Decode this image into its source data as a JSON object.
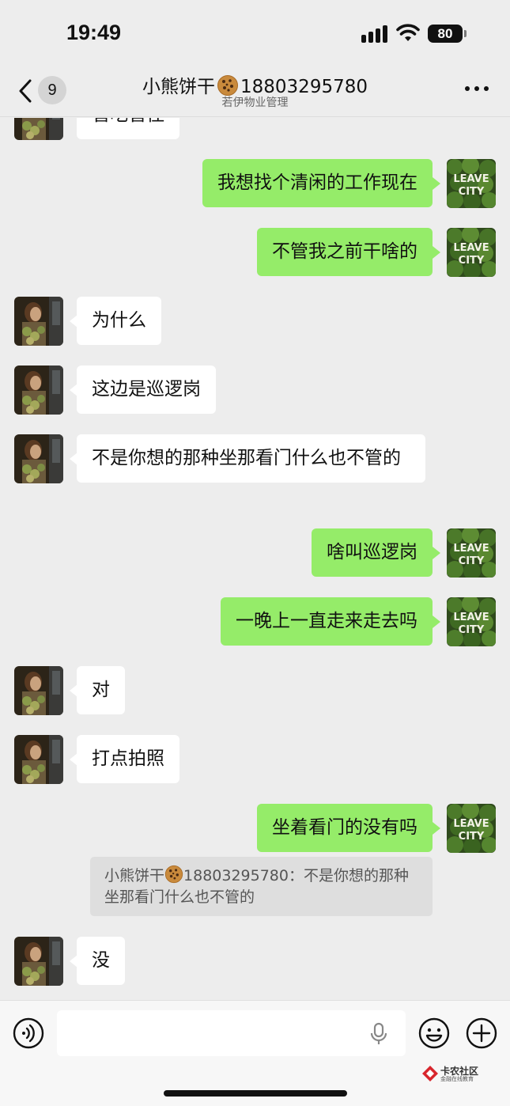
{
  "status_bar": {
    "time": "19:49",
    "battery": "80"
  },
  "nav": {
    "unread_count": "9",
    "title_name": "小熊饼干",
    "title_phone": "18803295780",
    "subtitle": "若伊物业管理"
  },
  "messages": {
    "m0": {
      "side": "in",
      "text": "管吃管住"
    },
    "m1": {
      "side": "out",
      "text": "我想找个清闲的工作现在"
    },
    "m2": {
      "side": "out",
      "text": "不管我之前干啥的"
    },
    "m3": {
      "side": "in",
      "text": "为什么"
    },
    "m4": {
      "side": "in",
      "text": "这边是巡逻岗"
    },
    "m5": {
      "side": "in",
      "text": "不是你想的那种坐那看门什么也不管的"
    },
    "m6": {
      "side": "out",
      "text": "啥叫巡逻岗"
    },
    "m7": {
      "side": "out",
      "text": "一晚上一直走来走去吗"
    },
    "m8": {
      "side": "in",
      "text": "对"
    },
    "m9": {
      "side": "in",
      "text": "打点拍照"
    },
    "m10": {
      "side": "out",
      "text": "坐着看门的没有吗"
    },
    "m11": {
      "side": "in",
      "text": "没"
    }
  },
  "quote": {
    "author": "小熊饼干",
    "author_phone": "18803295780",
    "separator": "：",
    "text": "不是你想的那种坐那看门什么也不管的"
  },
  "avatar_text": {
    "line1": "LEAVE",
    "line2": "CITY"
  },
  "input": {
    "value": ""
  },
  "watermark": {
    "title": "卡农社区",
    "subtitle": "金融在线教育"
  },
  "colors": {
    "background": "#ededed",
    "outgoing_bubble": "#95ec69",
    "incoming_bubble": "#ffffff"
  },
  "icons": [
    "back-chevron-icon",
    "more-icon",
    "voice-icon",
    "microphone-icon",
    "emoji-icon",
    "plus-icon",
    "cookie-emoji-icon"
  ]
}
